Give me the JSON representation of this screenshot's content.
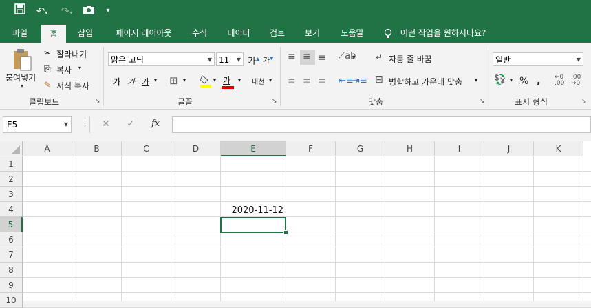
{
  "qat": {
    "save_icon": "save-icon",
    "undo_icon": "undo-icon",
    "redo_icon": "redo-icon",
    "camera_icon": "camera-icon",
    "customize_icon": "customize-qat-icon"
  },
  "tabs": [
    {
      "label": "파일"
    },
    {
      "label": "홈"
    },
    {
      "label": "삽입"
    },
    {
      "label": "페이지 레이아웃"
    },
    {
      "label": "수식"
    },
    {
      "label": "데이터"
    },
    {
      "label": "검토"
    },
    {
      "label": "보기"
    },
    {
      "label": "도움말"
    }
  ],
  "tell_me": "어떤 작업을 원하시나요?",
  "ribbon": {
    "clipboard": {
      "paste": "붙여넣기",
      "cut": "잘라내기",
      "copy": "복사",
      "format_painter": "서식 복사",
      "label": "클립보드"
    },
    "font": {
      "name": "맑은 고딕",
      "size": "11",
      "grow": "가",
      "shrink": "가",
      "bold": "가",
      "italic": "가",
      "underline": "가",
      "font_color_glyph": "가",
      "phonetic": "내천",
      "label": "글꼴"
    },
    "alignment": {
      "wrap": "자동 줄 바꿈",
      "merge": "병합하고 가운데 맞춤",
      "label": "맞춤"
    },
    "number": {
      "format": "일반",
      "percent": "%",
      "comma": ",",
      "label": "표시 형식"
    }
  },
  "formula_bar": {
    "name_box": "E5",
    "cancel": "✕",
    "enter": "✓",
    "fx": "fx",
    "value": ""
  },
  "sheet": {
    "columns": [
      "A",
      "B",
      "C",
      "D",
      "E",
      "F",
      "G",
      "H",
      "I",
      "J",
      "K"
    ],
    "rows": [
      "1",
      "2",
      "3",
      "4",
      "5",
      "6",
      "7",
      "8",
      "9",
      "10"
    ],
    "selected_column": "E",
    "selected_row": "5",
    "cells": {
      "E4": "2020-11-12"
    }
  },
  "colors": {
    "brand": "#217346",
    "font_color_bar": "#e00000",
    "highlight_bar": "#ffff00"
  }
}
